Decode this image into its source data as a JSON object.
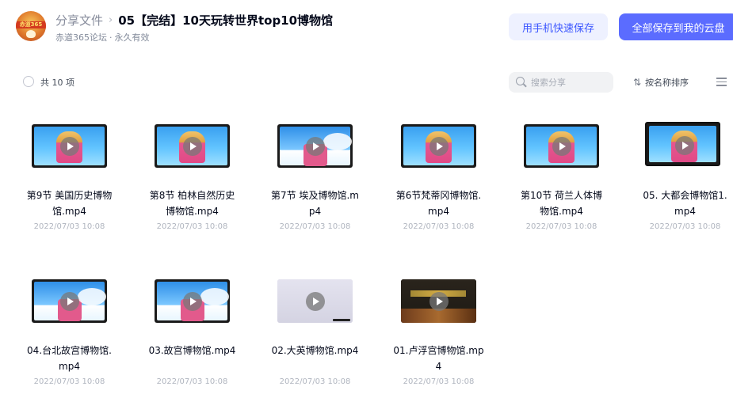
{
  "header": {
    "breadcrumb_parent": "分享文件",
    "breadcrumb_separator": "›",
    "breadcrumb_current": "05【完结】10天玩转世界top10博物馆",
    "sharer": "赤道365论坛",
    "validity": "永久有效",
    "avatar_text": "赤道365",
    "mobile_save_label": "用手机快速保存",
    "save_all_label": "全部保存到我的云盘"
  },
  "toolbar": {
    "count_label": "共 10 项",
    "search_placeholder": "搜索分享",
    "sort_label": "按名称排序",
    "sort_icon": "sort-arrows-icon",
    "view_icon": "list-view-icon"
  },
  "files": [
    {
      "name": "第9节 美国历史博物馆.mp4",
      "date": "2022/07/03 10:08",
      "thumb": "blue"
    },
    {
      "name": "第8节 柏林自然历史博物馆.mp4",
      "date": "2022/07/03 10:08",
      "thumb": "blue"
    },
    {
      "name": "第7节 埃及博物馆.mp4",
      "date": "2022/07/03 10:08",
      "thumb": "sky"
    },
    {
      "name": "第6节梵蒂冈博物馆.mp4",
      "date": "2022/07/03 10:08",
      "thumb": "blue"
    },
    {
      "name": "第10节 荷兰人体博物馆.mp4",
      "date": "2022/07/03 10:08",
      "thumb": "blue"
    },
    {
      "name": "05. 大都会博物馆1.mp4",
      "date": "2022/07/03 10:08",
      "thumb": "blue-framed"
    },
    {
      "name": "04.台北故宫博物馆.mp4",
      "date": "2022/07/03 10:08",
      "thumb": "sky"
    },
    {
      "name": "03.故宫博物馆.mp4",
      "date": "2022/07/03 10:08",
      "thumb": "sky"
    },
    {
      "name": "02.大英博物馆.mp4",
      "date": "2022/07/03 10:08",
      "thumb": "grey"
    },
    {
      "name": "01.卢浮宫博物馆.mp4",
      "date": "2022/07/03 10:08",
      "thumb": "dark"
    }
  ],
  "colors": {
    "accent": "#5b6cff",
    "accent_light": "#eef1ff",
    "text_primary": "#03081a",
    "text_secondary": "#818999"
  }
}
